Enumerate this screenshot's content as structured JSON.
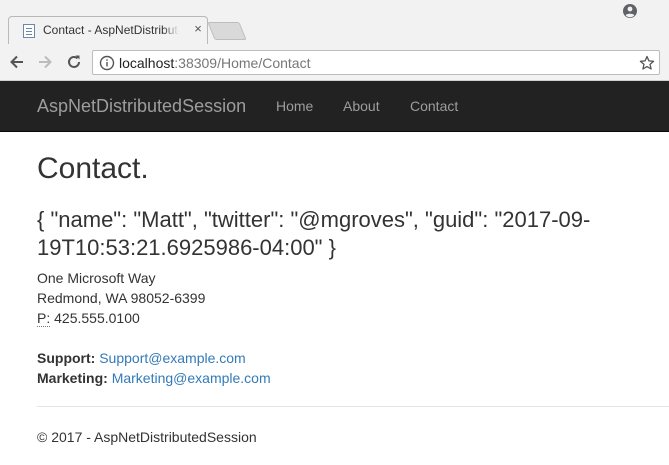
{
  "browser": {
    "tab_title": "Contact - AspNetDistributedSession",
    "tab_close": "×",
    "url_host": "localhost",
    "url_rest": ":38309/Home/Contact"
  },
  "navbar": {
    "brand": "AspNetDistributedSession",
    "links": [
      "Home",
      "About",
      "Contact"
    ]
  },
  "page": {
    "title": "Contact.",
    "session_json": "{ \"name\": \"Matt\", \"twitter\": \"@mgroves\", \"guid\": \"2017-09-19T10:53:21.6925986-04:00\" }",
    "address_line1": "One Microsoft Way",
    "address_line2": "Redmond, WA 98052-6399",
    "phone_label": "P:",
    "phone": "425.555.0100",
    "support_label": "Support:",
    "support_email": "Support@example.com",
    "marketing_label": "Marketing:",
    "marketing_email": "Marketing@example.com"
  },
  "footer": {
    "text": "© 2017 - AspNetDistributedSession"
  },
  "colors": {
    "navbar_bg": "#222222",
    "link": "#337ab7",
    "nav_text": "#9d9d9d"
  },
  "icons": [
    "page-favicon",
    "close-icon",
    "new-tab",
    "profile-icon",
    "back-arrow-icon",
    "forward-arrow-icon",
    "reload-icon",
    "info-icon",
    "star-icon"
  ]
}
